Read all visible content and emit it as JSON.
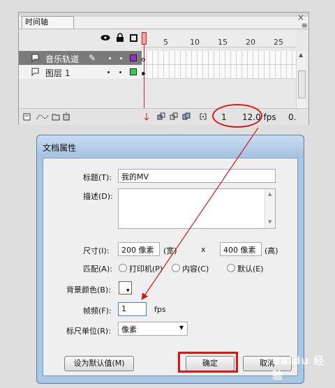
{
  "timeline": {
    "tab_label": "时间轴",
    "close_glyph": "×",
    "menu_glyph": "≡",
    "ruler_numbers": [
      "1",
      "5",
      "10",
      "15",
      "20",
      "25"
    ],
    "layers": [
      {
        "name": "音乐轨道",
        "selected": true,
        "color": "#9a2fd0"
      },
      {
        "name": "图层 1",
        "selected": false,
        "color": "#33cc55"
      }
    ],
    "status": {
      "frame_number": "1",
      "fps": "12.0 fps",
      "elapsed": "0."
    }
  },
  "dialog": {
    "title": "文档属性",
    "title_label": "标题(T):",
    "title_value": "我的MV",
    "desc_label": "描述(D):",
    "desc_value": "",
    "size_label": "尺寸(I):",
    "width_value": "200 像素",
    "width_unit": "(宽)",
    "x_sep": "x",
    "height_value": "400 像素",
    "height_unit": "(高)",
    "match_label": "匹配(A):",
    "match_options": [
      "打印机(P)",
      "内容(C)",
      "默认(E)"
    ],
    "bg_label": "背景颜色(B):",
    "bg_color": "#ffffff",
    "fps_label": "帧频(F):",
    "fps_value": "1",
    "fps_unit": "fps",
    "ruler_label": "标尺单位(R):",
    "ruler_value": "像素",
    "make_default_label": "设为默认值(M)",
    "ok_label": "确定",
    "cancel_label": "取消"
  },
  "annotation": {
    "color": "#d81818"
  },
  "watermark": "Baidu 经验"
}
